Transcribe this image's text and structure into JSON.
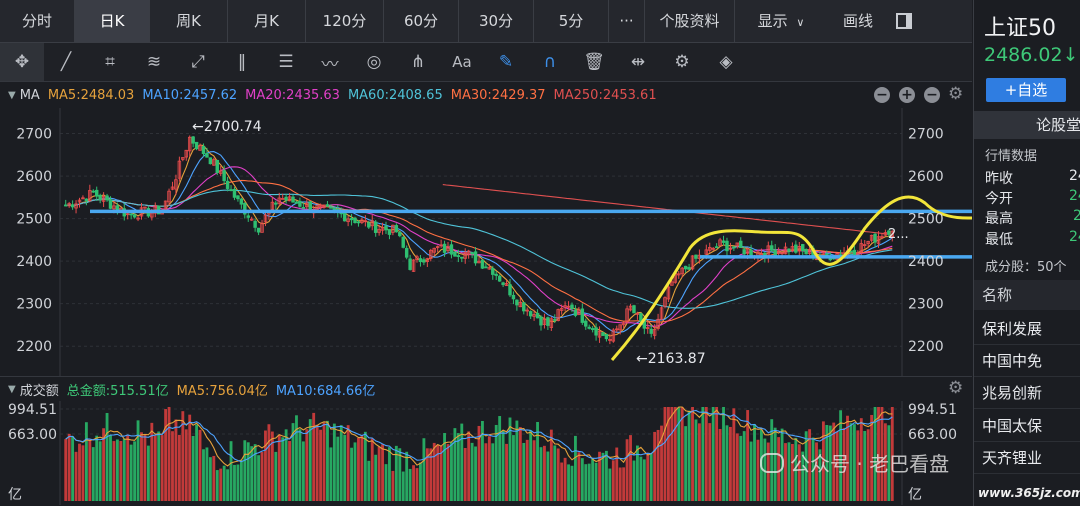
{
  "tabs": [
    {
      "label": "分时",
      "active": false
    },
    {
      "label": "日K",
      "active": true
    },
    {
      "label": "周K",
      "active": false
    },
    {
      "label": "月K",
      "active": false
    },
    {
      "label": "120分",
      "active": false
    },
    {
      "label": "60分",
      "active": false
    },
    {
      "label": "30分",
      "active": false
    },
    {
      "label": "5分",
      "active": false
    },
    {
      "label": "···",
      "active": false
    },
    {
      "label": "个股资料",
      "active": false
    }
  ],
  "view_menu": {
    "display_label": "显示",
    "display_icon": "chevron-down-icon",
    "draw_label": "画线"
  },
  "toolbar_icons": [
    "crosshair-icon",
    "line-icon",
    "crop-icon",
    "fan-icon",
    "ray-icon",
    "parallel-lines-icon",
    "fib-icon",
    "wave-icon",
    "circle-icon",
    "pitchfork-icon",
    "text-icon",
    "pen-icon",
    "magnet-icon",
    "trash-icon",
    "move-icon",
    "gear-icon",
    "layers-icon"
  ],
  "ma_legend": {
    "title": "MA",
    "items": [
      {
        "label": "MA5:2484.03",
        "color": "#e6a23c"
      },
      {
        "label": "MA10:2457.62",
        "color": "#4da3ff"
      },
      {
        "label": "MA20:2435.63",
        "color": "#e040c8"
      },
      {
        "label": "MA60:2408.65",
        "color": "#4fc3d8"
      },
      {
        "label": "MA30:2429.37",
        "color": "#ff7043"
      },
      {
        "label": "MA250:2453.61",
        "color": "#e05050"
      }
    ]
  },
  "vol_legend": {
    "title": "成交额",
    "items": [
      {
        "label": "总金额:515.51亿",
        "color": "#3ec878"
      },
      {
        "label": "MA5:756.04亿",
        "color": "#e6a23c"
      },
      {
        "label": "MA10:684.66亿",
        "color": "#4da3ff"
      }
    ]
  },
  "chart_data": {
    "type": "candlestick",
    "y_axis_ticks": [
      "2700",
      "2600",
      "2500",
      "2400",
      "2300",
      "2200"
    ],
    "ylim": [
      2130,
      2760
    ],
    "annotations": {
      "high": "←2700.74",
      "low": "←2163.87",
      "last_price_tag": "2..."
    },
    "volume_ticks": [
      "994.51",
      "663.00",
      "亿"
    ],
    "trend_lines": [
      {
        "label": "resistance",
        "price": 2517
      },
      {
        "label": "support",
        "price": 2410
      }
    ]
  },
  "quote": {
    "name": "上证50",
    "price": "2486.02",
    "price_arrow": "↓",
    "watch_button": "+自选",
    "forum_tab": "论股堂",
    "section": "行情数据",
    "rows": [
      {
        "label": "昨收",
        "value": "24"
      },
      {
        "label": "今开",
        "value": "24"
      },
      {
        "label": "最高",
        "value": "2"
      },
      {
        "label": "最低",
        "value": "24"
      }
    ],
    "constituents_label": "成分股：50个",
    "name_header": "名称",
    "stocks": [
      "保利发展",
      "中国中免",
      "兆易创新",
      "中国太保",
      "天齐锂业"
    ]
  },
  "watermark": {
    "text": "公众号 · 老巴看盘",
    "site": "www.365jz.com"
  }
}
